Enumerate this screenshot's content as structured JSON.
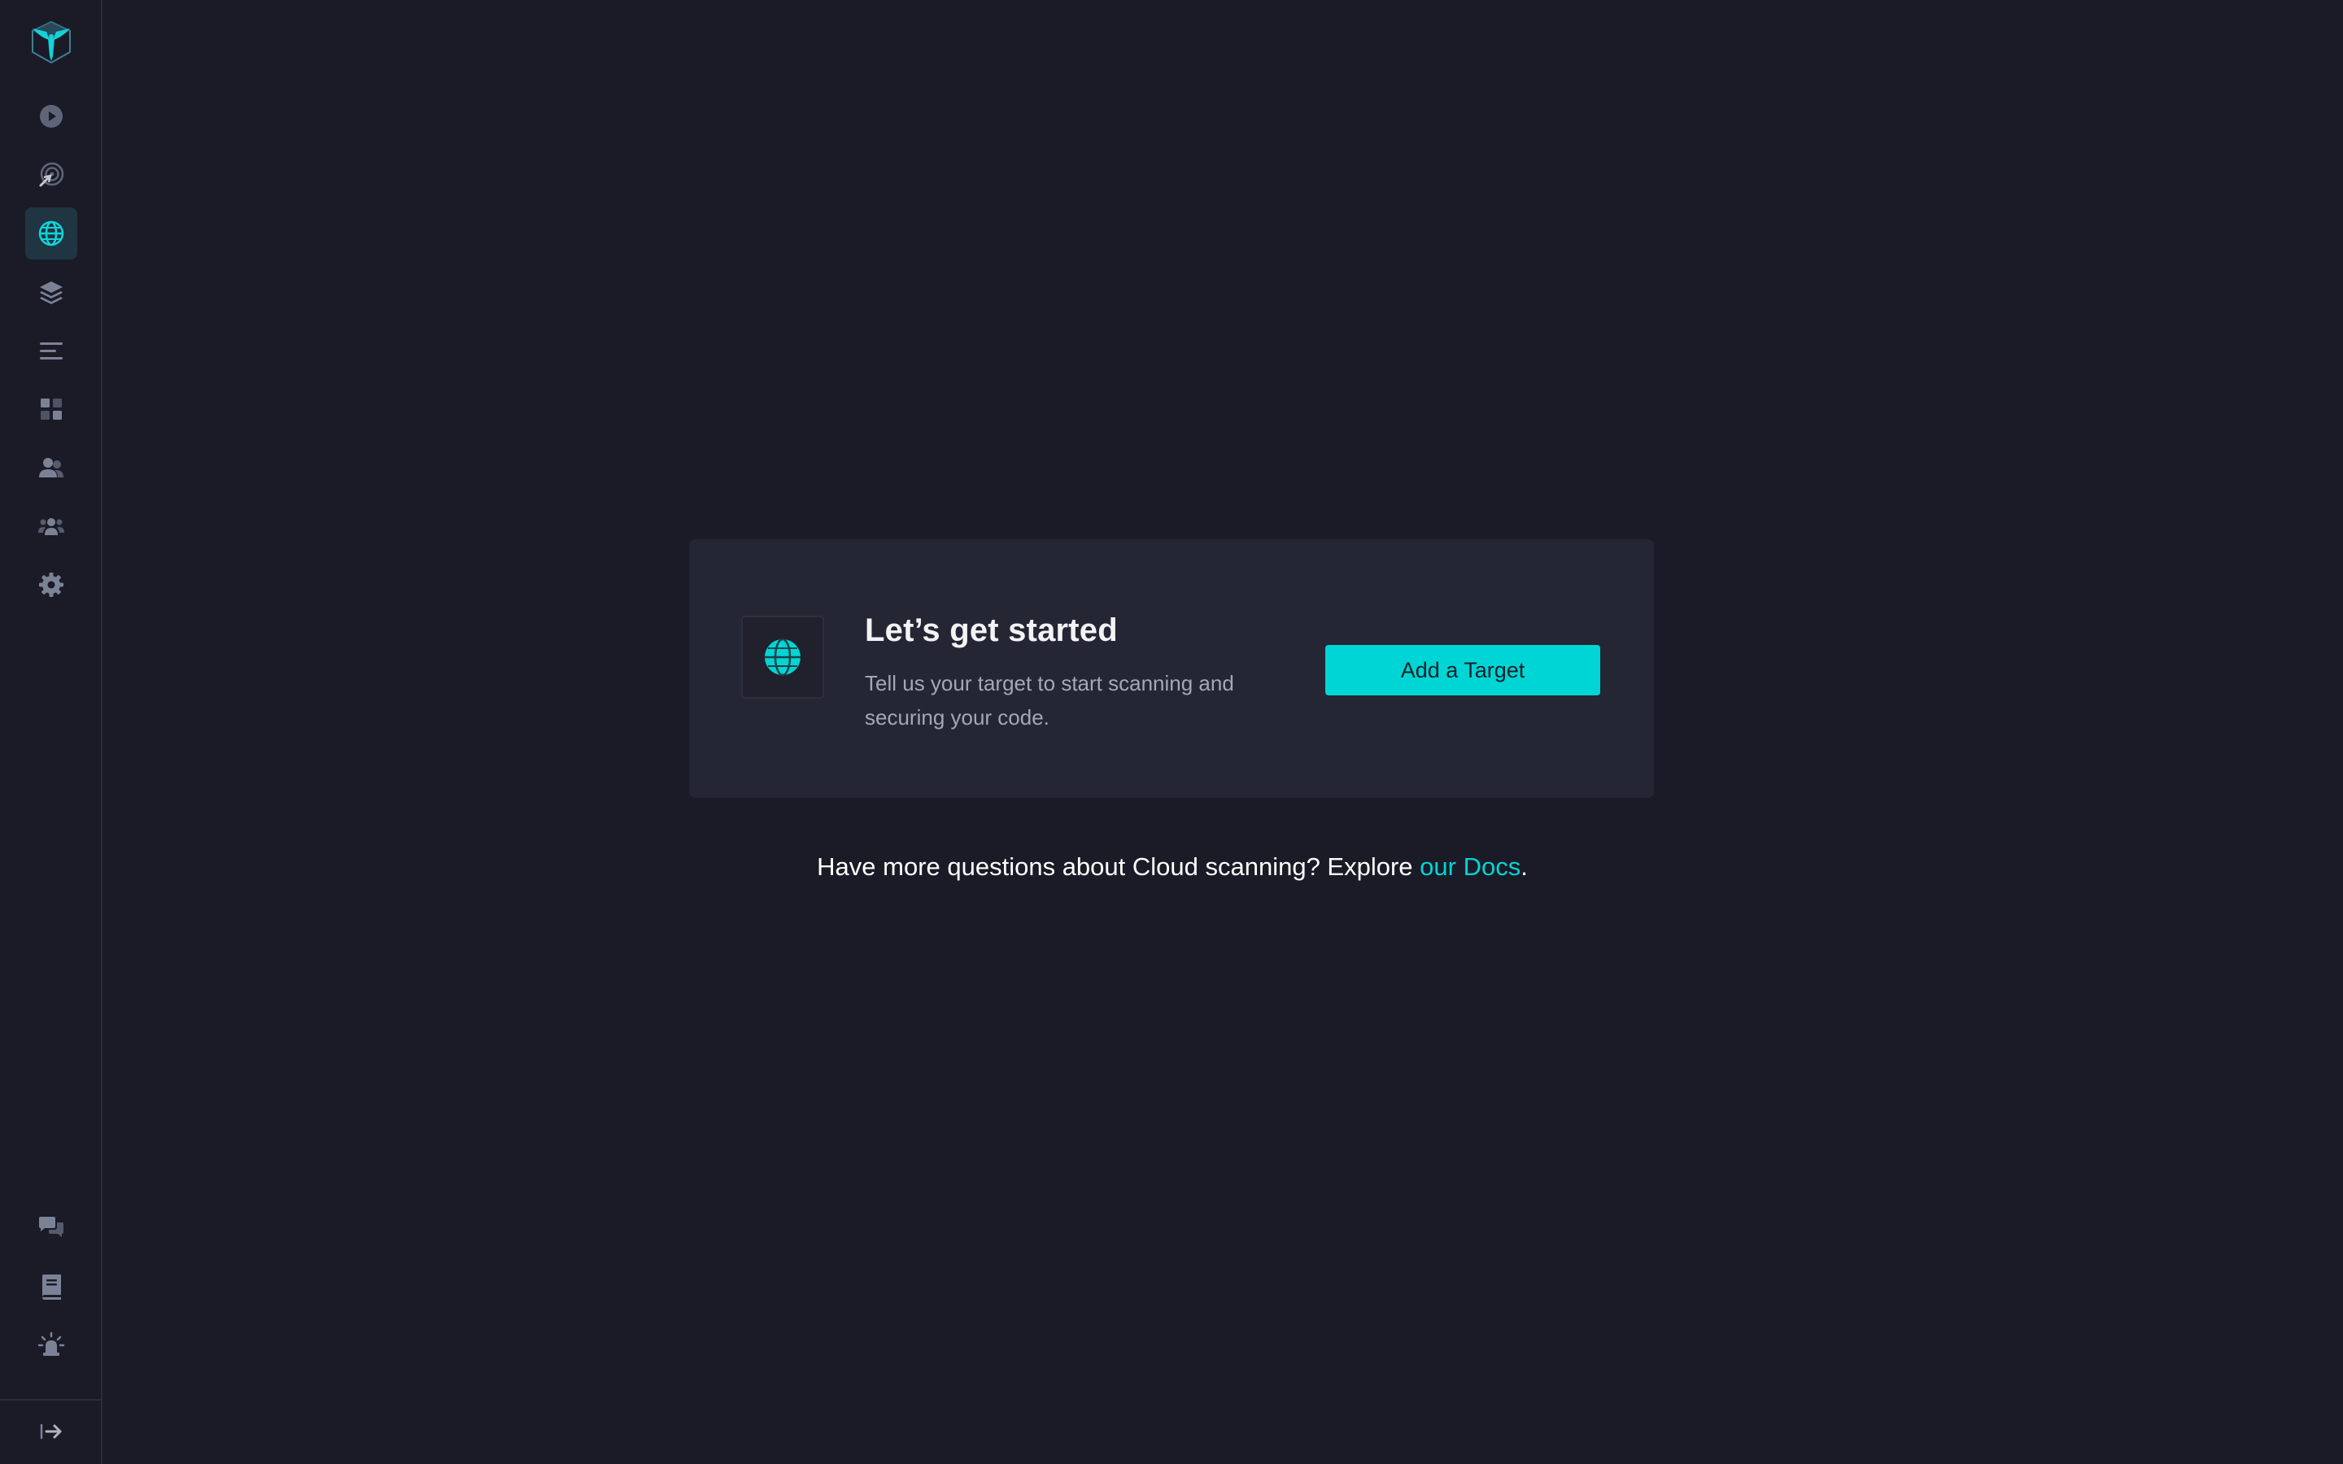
{
  "colors": {
    "background": "#1b1b28",
    "card": "#252633",
    "accent": "#00d5d5",
    "icon_muted": "#7c8296",
    "active_bg": "#1f3542"
  },
  "sidebar": {
    "logo_icon": "bird-cube-logo-icon",
    "items": [
      {
        "name": "scans",
        "icon": "play-circle-icon",
        "active": false
      },
      {
        "name": "scan-activity",
        "icon": "radar-icon",
        "active": false
      },
      {
        "name": "targets",
        "icon": "globe-icon",
        "active": true
      },
      {
        "name": "layers",
        "icon": "layers-icon",
        "active": false
      },
      {
        "name": "lists",
        "icon": "list-lines-icon",
        "active": false
      },
      {
        "name": "dashboard",
        "icon": "grid-blocks-icon",
        "active": false
      },
      {
        "name": "users",
        "icon": "users-icon",
        "active": false
      },
      {
        "name": "teams",
        "icon": "team-icon",
        "active": false
      },
      {
        "name": "settings",
        "icon": "gear-icon",
        "active": false
      }
    ],
    "bottom_items": [
      {
        "name": "chat",
        "icon": "chat-bubbles-icon"
      },
      {
        "name": "docs",
        "icon": "book-icon"
      },
      {
        "name": "report-bug",
        "icon": "bug-alert-icon"
      }
    ],
    "collapse_icon": "expand-arrow-icon"
  },
  "card": {
    "icon": "globe-icon",
    "title": "Let’s get started",
    "description": "Tell us your target to start scanning and securing your code.",
    "button_label": "Add a Target"
  },
  "footer": {
    "text": "Have more questions about Cloud scanning? Explore ",
    "link_text": "our Docs",
    "suffix": "."
  }
}
